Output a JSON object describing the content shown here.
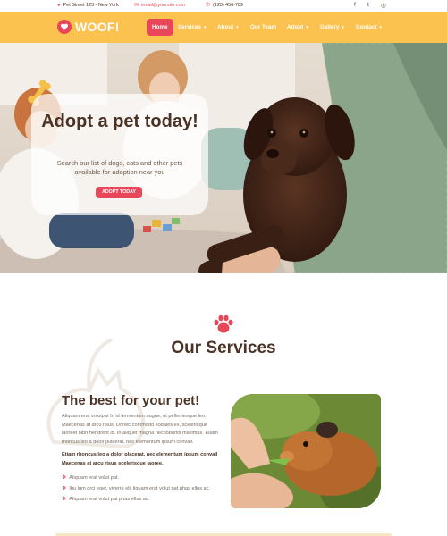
{
  "topbar": {
    "address": "Pet Street 123 - New York",
    "email": "email@yoursite.com",
    "phone": "(123) 456-789",
    "address_icon": "map-pin-icon",
    "email_icon": "envelope-icon",
    "phone_icon": "phone-icon",
    "social": [
      {
        "name": "facebook-icon",
        "glyph": "f"
      },
      {
        "name": "twitter-icon",
        "glyph": "t"
      },
      {
        "name": "instagram-icon",
        "glyph": "◎"
      }
    ]
  },
  "nav": {
    "logo_text": "WOOF!",
    "logo_icon": "heart-paw-icon",
    "items": [
      {
        "label": "Home",
        "active": true,
        "dropdown": false
      },
      {
        "label": "Services",
        "active": false,
        "dropdown": true
      },
      {
        "label": "About",
        "active": false,
        "dropdown": true
      },
      {
        "label": "Our Team",
        "active": false,
        "dropdown": false
      },
      {
        "label": "Adopt",
        "active": false,
        "dropdown": true
      },
      {
        "label": "Gallery",
        "active": false,
        "dropdown": true
      },
      {
        "label": "Contact",
        "active": false,
        "dropdown": true
      }
    ]
  },
  "hero": {
    "title": "Adopt a pet today!",
    "subtitle": "Search our list of dogs, cats and other pets available for adoption near you",
    "button": "ADOPT TODAY"
  },
  "services": {
    "title": "Our Services",
    "heading": "The best for your pet!",
    "paragraph1": "Aliquam erat volutpat In id fermentum augue, ut pellentesque leo. Maecenas at arcu risus. Donec commodo sodales ex, scelerisque laoreet nibh hendrerit id. In aliquet magna nec lobortis maximus. Etiam rhoncus leo a dolor placerat, nec elementum ipsum convall.",
    "paragraph2": "Etiam rhoncus leo a dolor placerat, nec elementum ipsum convall Maecenas at arcu risus scelerisque laoree.",
    "list": [
      "Aliquam erat volut pat.",
      "Ibu lum orci eget, viverra elit liquam erat volut pat phas ellus ac.",
      "Aliquam erat volut pat phas ellus ac."
    ]
  },
  "colors": {
    "brand_yellow": "#fbc24f",
    "accent_red": "#e8475a",
    "text_brown": "#4a3326"
  }
}
